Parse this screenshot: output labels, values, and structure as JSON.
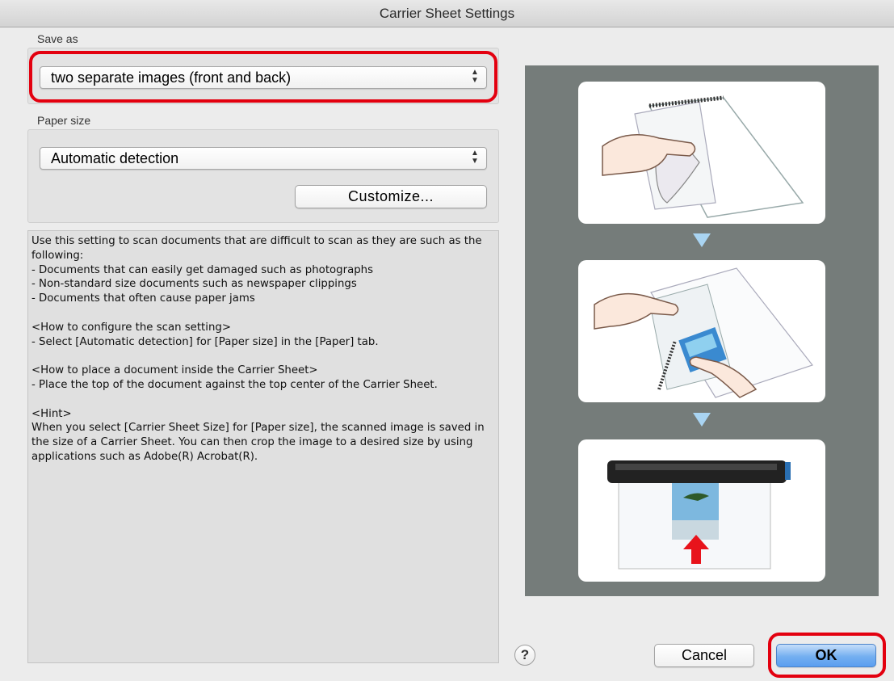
{
  "window": {
    "title": "Carrier Sheet Settings"
  },
  "save_as": {
    "label": "Save as",
    "selected": "two separate images (front and back)"
  },
  "paper_size": {
    "label": "Paper size",
    "selected": "Automatic detection",
    "customize_label": "Customize..."
  },
  "description": "Use this setting to scan documents that are difficult to scan as they are such as the following:\n- Documents that can easily get damaged such as photographs\n- Non-standard size documents such as newspaper clippings\n- Documents that often cause paper jams\n\n<How to configure the scan setting>\n- Select [Automatic detection] for [Paper size] in the [Paper] tab.\n\n<How to place a document inside the Carrier Sheet>\n- Place the top of the document against the top center of the Carrier Sheet.\n\n<Hint>\nWhen you select [Carrier Sheet Size] for [Paper size], the scanned image is saved in the size of a Carrier Sheet. You can then crop the image to a desired size by using applications such as Adobe(R) Acrobat(R).",
  "buttons": {
    "help": "?",
    "cancel": "Cancel",
    "ok": "OK"
  },
  "colors": {
    "highlight": "#e3000f",
    "illustration_bg": "#757c7a",
    "step_arrow": "#a9d4f2",
    "feed_arrow": "#e8131b"
  },
  "icons": {
    "popup": "up-down-chevrons",
    "help": "question-mark"
  }
}
